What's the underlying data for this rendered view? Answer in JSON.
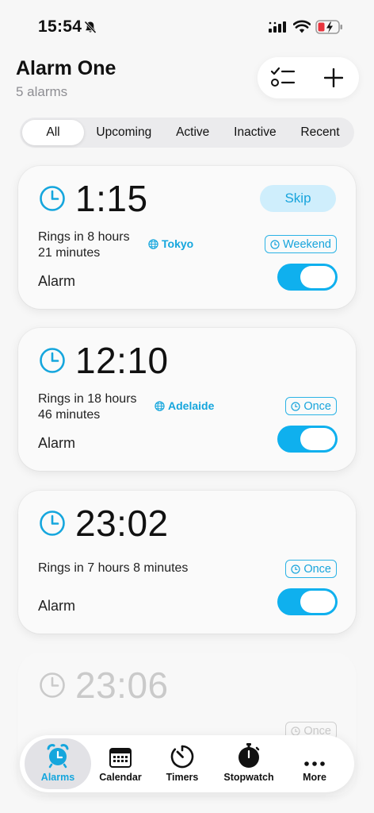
{
  "status_bar": {
    "time": "15:54"
  },
  "header": {
    "title": "Alarm One",
    "subtitle": "5 alarms"
  },
  "filters": [
    "All",
    "Upcoming",
    "Active",
    "Inactive",
    "Recent"
  ],
  "alarms": [
    {
      "time": "1:15",
      "skip_label": "Skip",
      "rings_line1": "Rings in 8 hours",
      "rings_line2": "21 minutes",
      "location": "Tokyo",
      "repeat": "Weekend",
      "label": "Alarm",
      "enabled": true
    },
    {
      "time": "12:10",
      "rings_line1": "Rings in 18 hours",
      "rings_line2": "46 minutes",
      "location": "Adelaide",
      "repeat": "Once",
      "label": "Alarm",
      "enabled": true
    },
    {
      "time": "23:02",
      "rings_line1": "Rings in 7 hours 8 minutes",
      "repeat": "Once",
      "label": "Alarm",
      "enabled": true
    },
    {
      "time": "23:06",
      "repeat": "Once"
    }
  ],
  "tabs": [
    {
      "label": "Alarms",
      "icon": "alarm-clock-icon"
    },
    {
      "label": "Calendar",
      "icon": "calendar-icon"
    },
    {
      "label": "Timers",
      "icon": "timer-icon"
    },
    {
      "label": "Stopwatch",
      "icon": "stopwatch-icon"
    },
    {
      "label": "More",
      "icon": "more-dots-icon"
    }
  ],
  "colors": {
    "accent": "#15a6dd",
    "toggle_on": "#0fb0ee",
    "skip_bg": "#cfeefc",
    "background": "#f7f7f7"
  }
}
